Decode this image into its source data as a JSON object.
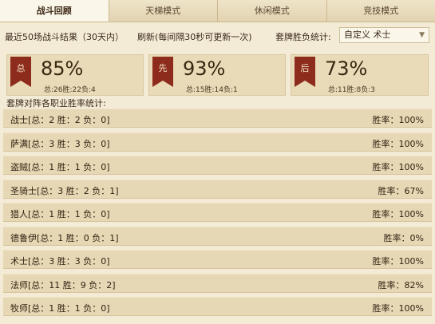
{
  "tabs": [
    "战斗回顾",
    "天梯模式",
    "休闲模式",
    "竞技模式"
  ],
  "header": {
    "summary": "最近50场战斗结果（30天内）",
    "refresh_link": "刷新",
    "refresh_note": "(每间隔30秒可更新一次)",
    "deck_stats_label": "套牌胜负统计:",
    "deck_select": "自定义 术士"
  },
  "cards": [
    {
      "flag": "总",
      "percent": "85%",
      "detail": "总:26胜:22负:4"
    },
    {
      "flag": "先",
      "percent": "93%",
      "detail": "总:15胜:14负:1"
    },
    {
      "flag": "后",
      "percent": "73%",
      "detail": "总:11胜:8负:3"
    }
  ],
  "class_stats_title": "套牌对阵各职业胜率统计:",
  "classes": [
    {
      "name": "战士[总：2 胜：2 负：0]",
      "rate": "胜率：100%"
    },
    {
      "name": "萨满[总：3 胜：3 负：0]",
      "rate": "胜率：100%"
    },
    {
      "name": "盗贼[总：1 胜：1 负：0]",
      "rate": "胜率：100%"
    },
    {
      "name": "圣骑士[总：3 胜：2 负：1]",
      "rate": "胜率：67%"
    },
    {
      "name": "猎人[总：1 胜：1 负：0]",
      "rate": "胜率：100%"
    },
    {
      "name": "德鲁伊[总：1 胜：0 负：1]",
      "rate": "胜率：0%"
    },
    {
      "name": "术士[总：3 胜：3 负：0]",
      "rate": "胜率：100%"
    },
    {
      "name": "法师[总：11 胜：9 负：2]",
      "rate": "胜率：82%"
    },
    {
      "name": "牧师[总：1 胜：1 负：0]",
      "rate": "胜率：100%"
    }
  ]
}
